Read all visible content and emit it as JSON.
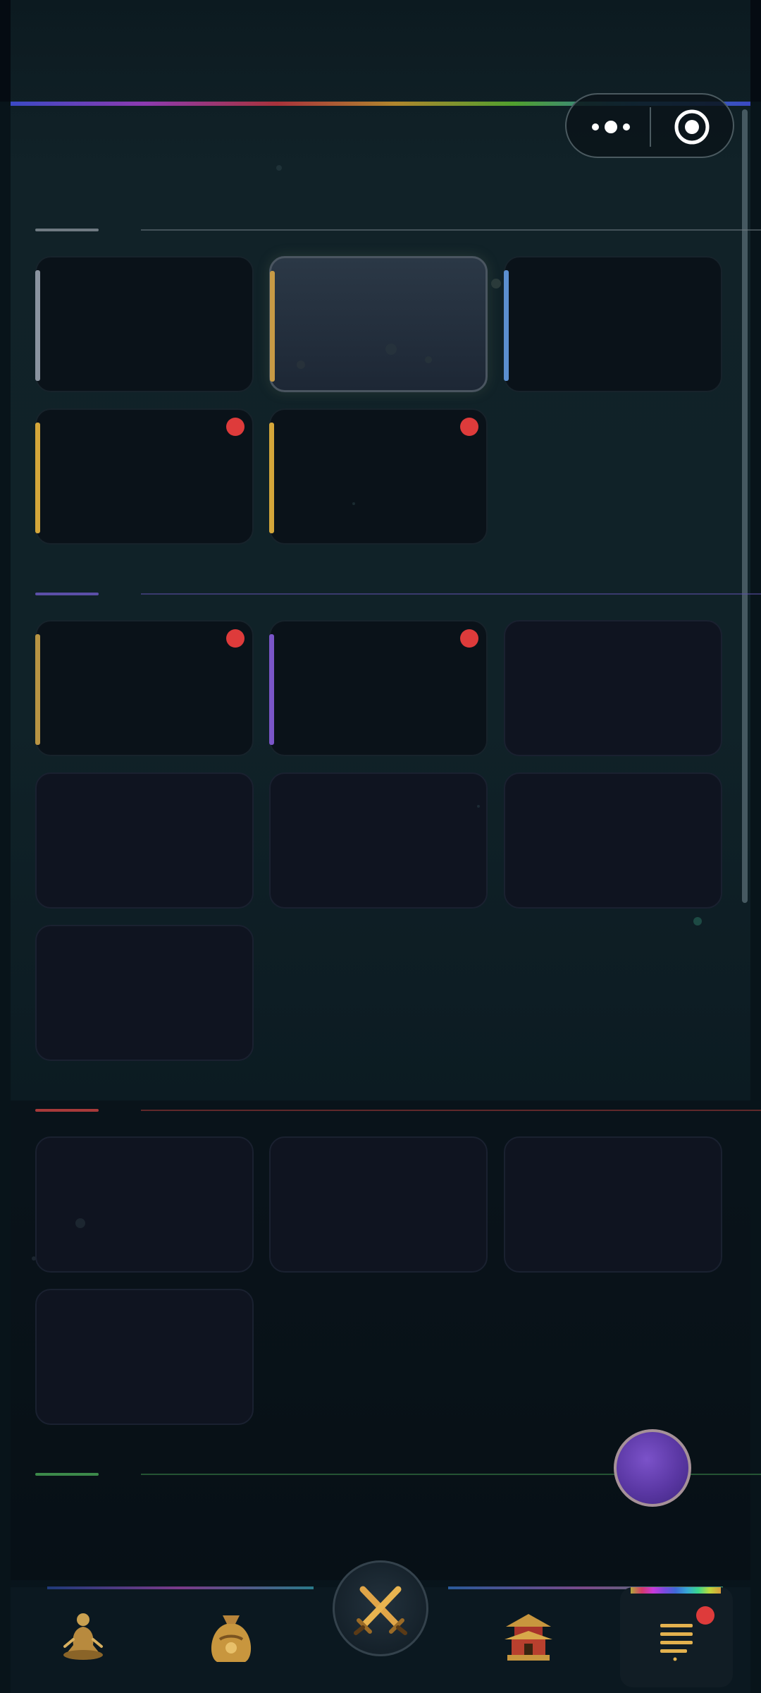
{
  "header": {
    "menu_capsule": {
      "more_icon": "more-dots-icon",
      "close_icon": "target-close-icon"
    }
  },
  "colors": {
    "background": "#102228",
    "card": "#0a1219",
    "card_dim": "#0f1420",
    "badge_red": "#de3b3b",
    "fab": "#5a37a3"
  },
  "sections": [
    {
      "accent_color": "#6f7a82",
      "cards": [
        {
          "bar_color": "#8a94a0",
          "badge": false,
          "selected": false
        },
        {
          "bar_color": "#c79a45",
          "badge": false,
          "selected": true
        },
        {
          "bar_color": "#5b8fd0",
          "badge": false,
          "selected": false
        },
        {
          "bar_color": "#d4a63a",
          "badge": true,
          "selected": false
        },
        {
          "bar_color": "#d4a63a",
          "badge": true,
          "selected": false
        }
      ]
    },
    {
      "accent_color": "#5b4fa8",
      "cards": [
        {
          "bar_color": "#b89443",
          "badge": true,
          "dim": false
        },
        {
          "bar_color": "#7a55c8",
          "badge": true,
          "dim": false
        },
        {
          "bar_color": "",
          "badge": false,
          "dim": true
        },
        {
          "bar_color": "",
          "badge": false,
          "dim": true
        },
        {
          "bar_color": "",
          "badge": false,
          "dim": true
        },
        {
          "bar_color": "",
          "badge": false,
          "dim": true
        },
        {
          "bar_color": "",
          "badge": false,
          "dim": true
        }
      ]
    },
    {
      "accent_color": "#a83a3a",
      "cards": [
        {
          "bar_color": "",
          "badge": false,
          "dim": true
        },
        {
          "bar_color": "",
          "badge": false,
          "dim": true
        },
        {
          "bar_color": "",
          "badge": false,
          "dim": true
        },
        {
          "bar_color": "",
          "badge": false,
          "dim": true
        }
      ]
    },
    {
      "accent_color": "#3c8a4a",
      "cards": []
    }
  ],
  "bottom_nav": {
    "tabs": [
      {
        "icon": "meditation-figure-icon",
        "active": false,
        "badge": false
      },
      {
        "icon": "treasure-bag-icon",
        "active": false,
        "badge": false
      },
      {
        "icon": "crossed-swords-icon",
        "active": false,
        "badge": false
      },
      {
        "icon": "pagoda-icon",
        "active": false,
        "badge": false
      },
      {
        "icon": "menu-list-icon",
        "active": true,
        "badge": true
      }
    ]
  },
  "fab": {
    "icon": "purple-orb-icon"
  }
}
